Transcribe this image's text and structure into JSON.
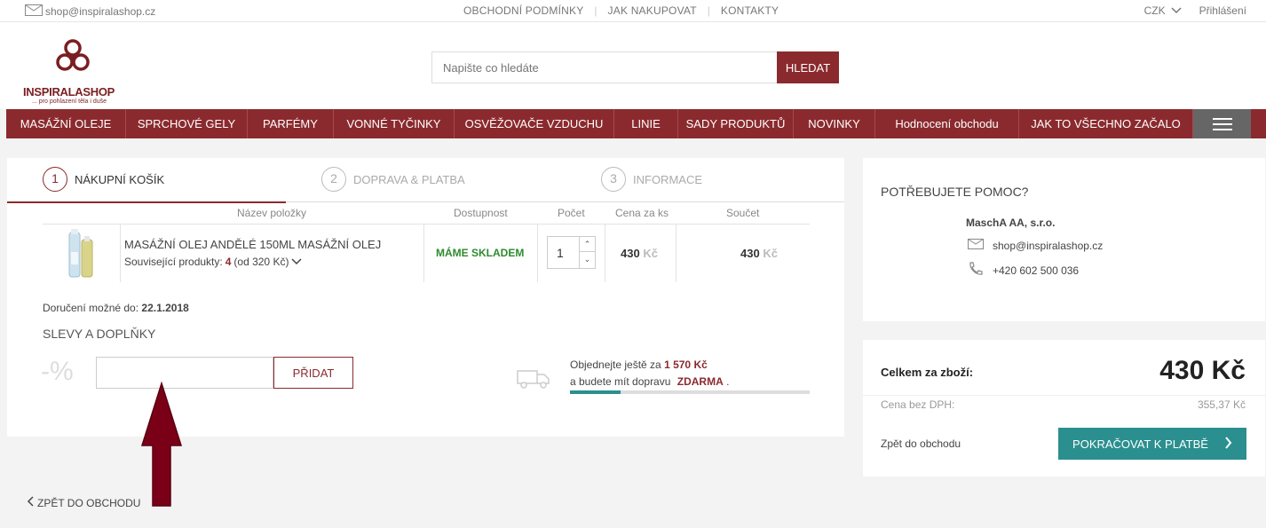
{
  "topbar": {
    "email": "shop@inspiralashop.cz",
    "links": [
      "OBCHODNÍ PODMÍNKY",
      "JAK NAKUPOVAT",
      "KONTAKTY"
    ],
    "currency": "CZK",
    "login": "Přihlášení"
  },
  "header": {
    "logo_name": "INSPIRALASHOP",
    "logo_tagline": "... pro pohlazení těla i duše",
    "search_placeholder": "Napište co hledáte",
    "search_button": "HLEDAT"
  },
  "nav": {
    "items": [
      "MASÁŽNÍ OLEJE",
      "SPRCHOVÉ GELY",
      "PARFÉMY",
      "VONNÉ TYČINKY",
      "OSVĚŽOVAČE VZDUCHU",
      "LINIE",
      "SADY PRODUKTŮ",
      "NOVINKY",
      "Hodnocení obchodu",
      "JAK TO VŠECHNO ZAČALO"
    ]
  },
  "steps": [
    {
      "num": "1",
      "label": "NÁKUPNÍ KOŠÍK"
    },
    {
      "num": "2",
      "label": "DOPRAVA & PLATBA"
    },
    {
      "num": "3",
      "label": "INFORMACE"
    }
  ],
  "cart": {
    "headers": {
      "name": "Název položky",
      "availability": "Dostupnost",
      "qty": "Počet",
      "unit_price": "Cena za ks",
      "total": "Součet"
    },
    "item": {
      "name": "MASÁŽNÍ OLEJ ANDĚLÉ 150ML MASÁŽNÍ OLEJ",
      "related_label": "Související produkty:",
      "related_count": "4",
      "related_from": "(od 320 Kč)",
      "availability": "MÁME SKLADEM",
      "qty": "1",
      "unit_price": "430",
      "total": "430",
      "currency": "Kč"
    },
    "delivery_label": "Doručení možné do:",
    "delivery_date": "22.1.2018",
    "discounts_title": "SLEVY A DOPLŇKY",
    "discount_symbol": "-%",
    "add_button": "PŘIDAT",
    "shipping": {
      "line1_prefix": "Objednejte ještě za",
      "amount": "1 570 Kč",
      "line2_prefix": "a budete mít dopravu",
      "free": "ZDARMA",
      "line2_suffix": ".",
      "progress": 0.21
    },
    "back_link": "ZPĚT DO OBCHODU"
  },
  "help": {
    "title": "POTŘEBUJETE POMOC?",
    "company": "MaschA AA, s.r.o.",
    "email": "shop@inspiralashop.cz",
    "phone": "+420 602 500 036"
  },
  "summary": {
    "total_label": "Celkem za zboží:",
    "total_value": "430 Kč",
    "net_label": "Cena bez DPH:",
    "net_value": "355,37 Kč",
    "back": "Zpět do obchodu",
    "continue": "POKRAČOVAT K PLATBĚ"
  },
  "colors": {
    "brand": "#8b2a2e",
    "teal": "#2b8f8f",
    "green": "#2e8b2e"
  }
}
